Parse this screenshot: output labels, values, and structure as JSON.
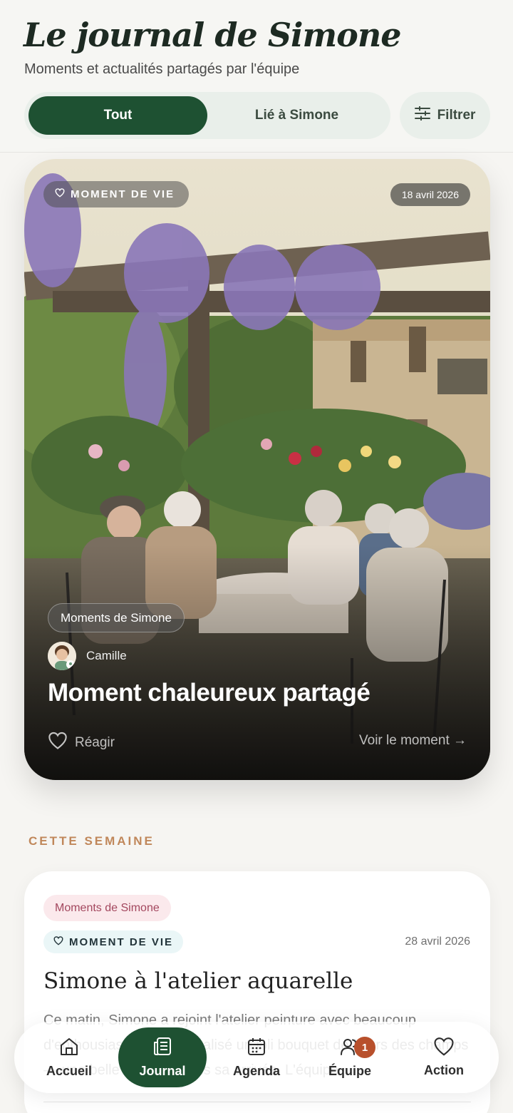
{
  "header": {
    "title": "Le journal de Simone",
    "subtitle": "Moments et actualités partagés par l'équipe",
    "tabs": [
      {
        "label": "Tout",
        "active": true
      },
      {
        "label": "Lié à Simone",
        "active": false
      }
    ],
    "filter_label": "Filtrer"
  },
  "featured": {
    "tag": "MOMENT DE VIE",
    "tag_icon": "heart-icon",
    "date": "18 avril 2026",
    "category": "Moments de Simone",
    "author": "Camille",
    "title": "Moment chaleureux partagé",
    "react_label": "Réagir",
    "view_label": "Voir le moment →"
  },
  "section": {
    "label": "CETTE SEMAINE"
  },
  "posts": [
    {
      "category": "Moments de Simone",
      "tag": "MOMENT DE VIE",
      "date": "28 avril 2026",
      "title": "Simone à l'atelier aquarelle",
      "body": "Ce matin, Simone a rejoint l'atelier peinture avec beaucoup d'enthousiasme. Elle a réalisé un joli bouquet de fleurs des champs — une belle œuvre depuis sa arrivée. L'équipe"
    }
  ],
  "nav": {
    "items": [
      {
        "label": "Accueil",
        "icon": "home-icon"
      },
      {
        "label": "Journal",
        "icon": "newspaper-icon",
        "active": true
      },
      {
        "label": "Agenda",
        "icon": "calendar-icon"
      },
      {
        "label": "Équipe",
        "icon": "team-icon",
        "badge": "1"
      },
      {
        "label": "Action",
        "icon": "heart-icon"
      }
    ]
  },
  "colors": {
    "brand_green": "#1e5132",
    "segment_bg": "#e9efea",
    "section_accent": "#c0875a",
    "category_pink": "#a3475e",
    "badge": "#b8502c"
  }
}
